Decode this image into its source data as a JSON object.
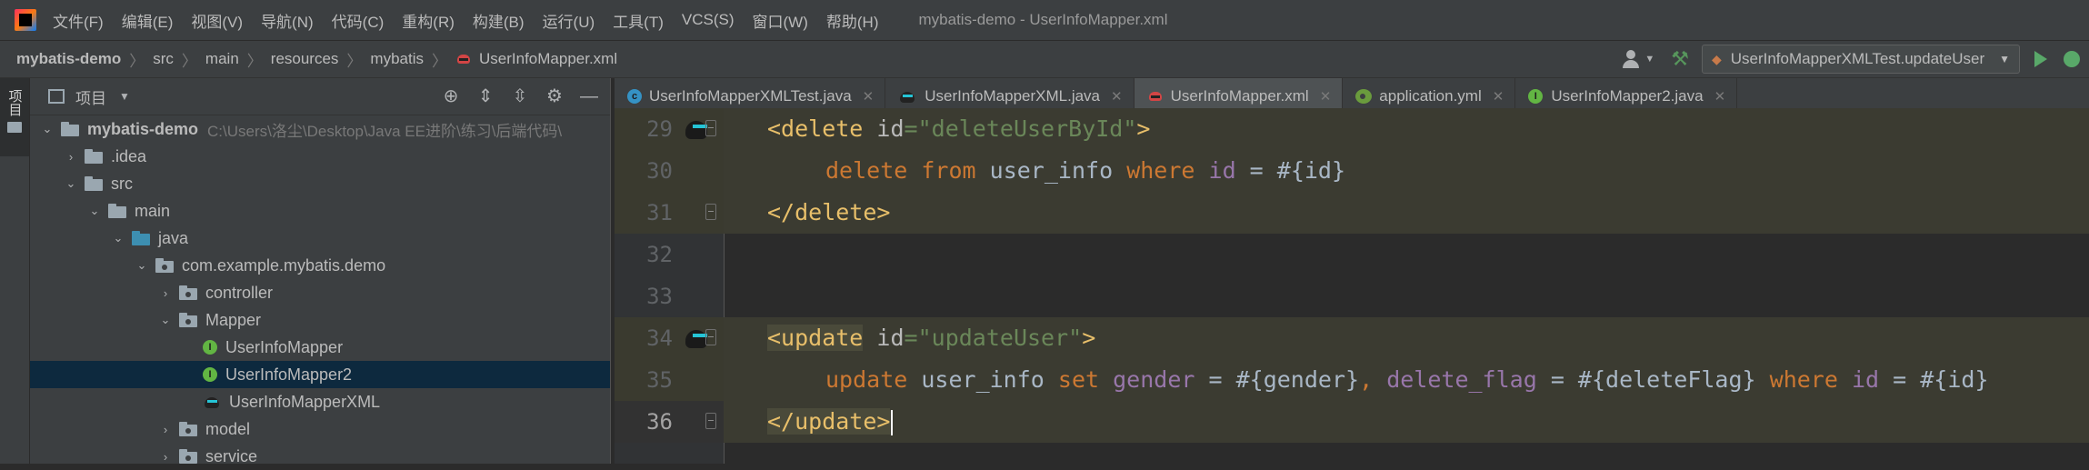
{
  "window": {
    "title": "mybatis-demo - UserInfoMapper.xml",
    "menu": [
      "文件(F)",
      "编辑(E)",
      "视图(V)",
      "导航(N)",
      "代码(C)",
      "重构(R)",
      "构建(B)",
      "运行(U)",
      "工具(T)",
      "VCS(S)",
      "窗口(W)",
      "帮助(H)"
    ]
  },
  "breadcrumb": [
    "mybatis-demo",
    "src",
    "main",
    "resources",
    "mybatis",
    "UserInfoMapper.xml"
  ],
  "toolbar": {
    "run_config": "UserInfoMapperXMLTest.updateUser"
  },
  "toolstrip": {
    "project_tab": "项目"
  },
  "project_panel": {
    "title": "项目",
    "tree": [
      {
        "label": "mybatis-demo",
        "path": "C:\\Users\\洛尘\\Desktop\\Java EE进阶\\练习\\后端代码\\"
      },
      {
        "label": ".idea"
      },
      {
        "label": "src"
      },
      {
        "label": "main"
      },
      {
        "label": "java"
      },
      {
        "label": "com.example.mybatis.demo"
      },
      {
        "label": "controller"
      },
      {
        "label": "Mapper"
      },
      {
        "label": "UserInfoMapper"
      },
      {
        "label": "UserInfoMapper2"
      },
      {
        "label": "UserInfoMapperXML"
      },
      {
        "label": "model"
      },
      {
        "label": "service"
      }
    ]
  },
  "editor": {
    "tabs": [
      {
        "label": "UserInfoMapperXMLTest.java",
        "icon": "class-icon"
      },
      {
        "label": "UserInfoMapperXML.java",
        "icon": "mybatis-icon"
      },
      {
        "label": "UserInfoMapper.xml",
        "icon": "mybatis-xml-icon",
        "active": true
      },
      {
        "label": "application.yml",
        "icon": "yml-icon"
      },
      {
        "label": "UserInfoMapper2.java",
        "icon": "interface-icon"
      }
    ],
    "line_numbers": [
      "29",
      "30",
      "31",
      "32",
      "33",
      "34",
      "35",
      "36"
    ],
    "code": {
      "l29": {
        "open": "<delete",
        "attr": "id",
        "eq": "=",
        "val": "\"deleteUserById\"",
        "close": ">"
      },
      "l30": {
        "kw1": "delete",
        "kw2": "from",
        "table": "user_info",
        "kw3": "where",
        "col": "id",
        "rest": " = #{id}"
      },
      "l31": {
        "tag": "</delete>"
      },
      "l34": {
        "open": "<update",
        "attr": "id",
        "eq": "=",
        "val": "\"updateUser\"",
        "close": ">"
      },
      "l35": {
        "kw1": "update",
        "table": "user_info",
        "kw2": "set",
        "col1": "gender",
        "mid1": " = #{gender}",
        "comma": ",",
        "col2": "delete_flag",
        "mid2": " = #{deleteFlag}",
        "kw3": "where",
        "col3": "id",
        "rest": " = #{id}"
      },
      "l36": {
        "tag": "</update>"
      }
    }
  }
}
